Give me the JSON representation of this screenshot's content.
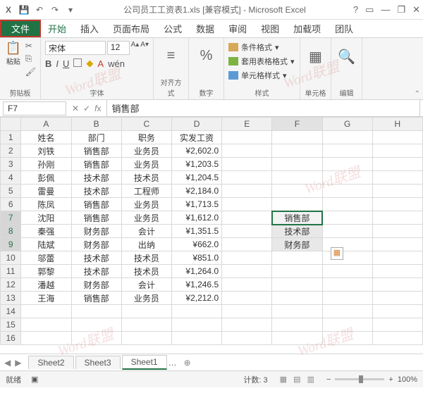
{
  "title": "公司员工工资表1.xls [兼容模式] - Microsoft Excel",
  "tabs": {
    "file": "文件",
    "home": "开始",
    "insert": "插入",
    "layout": "页面布局",
    "formula": "公式",
    "data": "数据",
    "review": "审阅",
    "view": "视图",
    "addin": "加载项",
    "team": "团队"
  },
  "ribbon": {
    "paste": "粘贴",
    "clipboard": "剪贴板",
    "font_name": "宋体",
    "font_size": "12",
    "font_label": "字体",
    "align": "对齐方式",
    "number": "数字",
    "cond_fmt": "条件格式",
    "table_fmt": "套用表格格式",
    "cell_fmt": "单元格样式",
    "styles": "样式",
    "cells": "单元格",
    "edit": "编辑"
  },
  "namebox": "F7",
  "formula": "销售部",
  "cols": [
    "A",
    "B",
    "C",
    "D",
    "E",
    "F",
    "G",
    "H"
  ],
  "rows": [
    {
      "r": "1",
      "a": "姓名",
      "b": "部门",
      "c": "职务",
      "d": "实发工资"
    },
    {
      "r": "2",
      "a": "刘铁",
      "b": "销售部",
      "c": "业务员",
      "d": "¥2,602.0"
    },
    {
      "r": "3",
      "a": "孙刚",
      "b": "销售部",
      "c": "业务员",
      "d": "¥1,203.5"
    },
    {
      "r": "4",
      "a": "彭佩",
      "b": "技术部",
      "c": "技术员",
      "d": "¥1,204.5"
    },
    {
      "r": "5",
      "a": "雷曼",
      "b": "技术部",
      "c": "工程师",
      "d": "¥2,184.0"
    },
    {
      "r": "6",
      "a": "陈凤",
      "b": "销售部",
      "c": "业务员",
      "d": "¥1,713.5"
    },
    {
      "r": "7",
      "a": "沈阳",
      "b": "销售部",
      "c": "业务员",
      "d": "¥1,612.0"
    },
    {
      "r": "8",
      "a": "秦强",
      "b": "财务部",
      "c": "会计",
      "d": "¥1,351.5"
    },
    {
      "r": "9",
      "a": "陆斌",
      "b": "财务部",
      "c": "出纳",
      "d": "¥662.0"
    },
    {
      "r": "10",
      "a": "邬蕾",
      "b": "技术部",
      "c": "技术员",
      "d": "¥851.0"
    },
    {
      "r": "11",
      "a": "郭黎",
      "b": "技术部",
      "c": "技术员",
      "d": "¥1,264.0"
    },
    {
      "r": "12",
      "a": "潘越",
      "b": "财务部",
      "c": "会计",
      "d": "¥1,246.5"
    },
    {
      "r": "13",
      "a": "王海",
      "b": "销售部",
      "c": "业务员",
      "d": "¥2,212.0"
    },
    {
      "r": "14",
      "a": "",
      "b": "",
      "c": "",
      "d": ""
    },
    {
      "r": "15",
      "a": "",
      "b": "",
      "c": "",
      "d": ""
    },
    {
      "r": "16",
      "a": "",
      "b": "",
      "c": "",
      "d": ""
    }
  ],
  "filter": {
    "f7": "销售部",
    "f8": "技术部",
    "f9": "财务部"
  },
  "sheets": {
    "s2": "Sheet2",
    "s3": "Sheet3",
    "s1": "Sheet1"
  },
  "status": {
    "ready": "就绪",
    "count_lbl": "计数:",
    "count": "3",
    "zoom": "100%"
  },
  "watermark": "Word联盟"
}
